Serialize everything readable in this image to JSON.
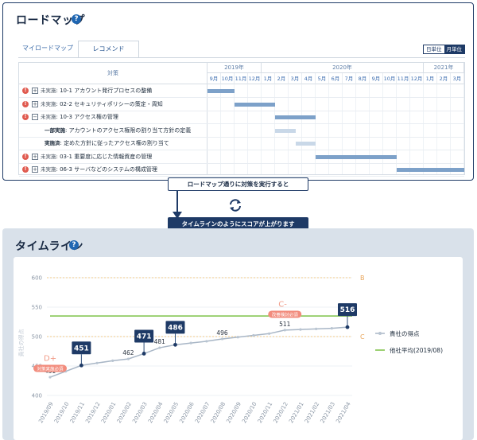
{
  "roadmap": {
    "title": "ロードマップ",
    "help_icon": "?",
    "tabs": [
      "マイロードマップ",
      "レコメンド"
    ],
    "active_tab": "レコメンド",
    "unit_switch": [
      "日単位",
      "月単位"
    ],
    "active_unit": "月単位",
    "header_task": "対策",
    "years": [
      "2019年",
      "2020年",
      "2021年"
    ],
    "months": [
      "9月",
      "10月",
      "11月",
      "12月",
      "1月",
      "2月",
      "3月",
      "4月",
      "5月",
      "6月",
      "7月",
      "8月",
      "9月",
      "10月",
      "11月",
      "12月",
      "1月",
      "2月",
      "3月"
    ],
    "rows": [
      {
        "kind": "task",
        "alert": true,
        "expand": "+",
        "status": "未実施",
        "label": ": 10-1 アカウント発行プロセスの整備",
        "start": 0,
        "end": 2
      },
      {
        "kind": "task",
        "alert": true,
        "expand": "+",
        "status": "未実施",
        "label": ": 02-2 セキュリティポリシーの策定・周知",
        "start": 2,
        "end": 5
      },
      {
        "kind": "task",
        "alert": true,
        "expand": "−",
        "status": "未実施",
        "label": ": 10-3 アクセス権の管理",
        "start": 5,
        "end": 8
      },
      {
        "kind": "sub",
        "status": "一部実施",
        "label": ": アカウントのアクセス権限の割り当て方針の定義",
        "start": 5,
        "end": 6.5,
        "light": true
      },
      {
        "kind": "sub",
        "status": "実施済",
        "label": ": 定めた方針に従ったアクセス権の割り当て",
        "start": 6.5,
        "end": 8,
        "light": true
      },
      {
        "kind": "task",
        "alert": true,
        "expand": "+",
        "status": "未実施",
        "label": ": 03-1 重要度に応じた情報資産の管理",
        "start": 8,
        "end": 14
      },
      {
        "kind": "task",
        "alert": true,
        "expand": "+",
        "status": "未実施",
        "label": ": 06-3 サーバなどのシステムの構成管理",
        "start": 14,
        "end": 19
      }
    ]
  },
  "middle": {
    "callout_top": "ロードマップ通りに対策を実行すると",
    "callout_bottom": "タイムラインのようにスコアが上がります",
    "refresh_icon": "refresh-icon",
    "arrow_icon": "down-arrow-icon"
  },
  "timeline": {
    "title": "タイムライン",
    "help_icon": "?"
  },
  "chart_data": {
    "type": "line",
    "x": [
      "2019/09",
      "2019/10",
      "2019/11",
      "2019/12",
      "2020/01",
      "2020/02",
      "2020/03",
      "2020/04",
      "2020/05",
      "2020/06",
      "2020/07",
      "2020/08",
      "2020/09",
      "2020/10",
      "2020/11",
      "2020/12",
      "2021/01",
      "2021/02",
      "2021/03",
      "2021/04"
    ],
    "series": [
      {
        "name": "貴社の得点",
        "color": "#a8b6c6",
        "values": [
          431,
          441,
          451,
          455,
          459,
          462,
          471,
          481,
          486,
          489,
          492,
          496,
          499,
          502,
          505,
          511,
          512,
          513,
          514,
          516
        ]
      }
    ],
    "reference": {
      "name": "他社平均(2019/08)",
      "value": 535,
      "color": "#7ac143"
    },
    "grade_lines": [
      {
        "label": "B",
        "value": 600,
        "color": "#f0c987"
      },
      {
        "label": "C",
        "value": 500,
        "color": "#f0c987"
      }
    ],
    "labeled_points": [
      {
        "x": "2019/09",
        "value": 431,
        "boxed": false
      },
      {
        "x": "2019/11",
        "value": 451,
        "boxed": true
      },
      {
        "x": "2020/02",
        "value": 462,
        "boxed": false
      },
      {
        "x": "2020/03",
        "value": 471,
        "boxed": true
      },
      {
        "x": "2020/04",
        "value": 481,
        "boxed": false
      },
      {
        "x": "2020/05",
        "value": 486,
        "boxed": true
      },
      {
        "x": "2020/08",
        "value": 496,
        "boxed": false
      },
      {
        "x": "2020/12",
        "value": 511,
        "boxed": false
      },
      {
        "x": "2021/04",
        "value": 516,
        "boxed": true
      }
    ],
    "grade_badges": [
      {
        "grade": "D+",
        "note": "対策実施必須",
        "x": "2019/09",
        "value": 456
      },
      {
        "grade": "C-",
        "note": "改善検討必須",
        "x": "2020/12",
        "value": 548
      }
    ],
    "ylabel": "貴社の得点",
    "ylim": [
      400,
      600
    ],
    "yticks": [
      400,
      450,
      500,
      550,
      600
    ],
    "legend_position": "right",
    "grid": true
  }
}
